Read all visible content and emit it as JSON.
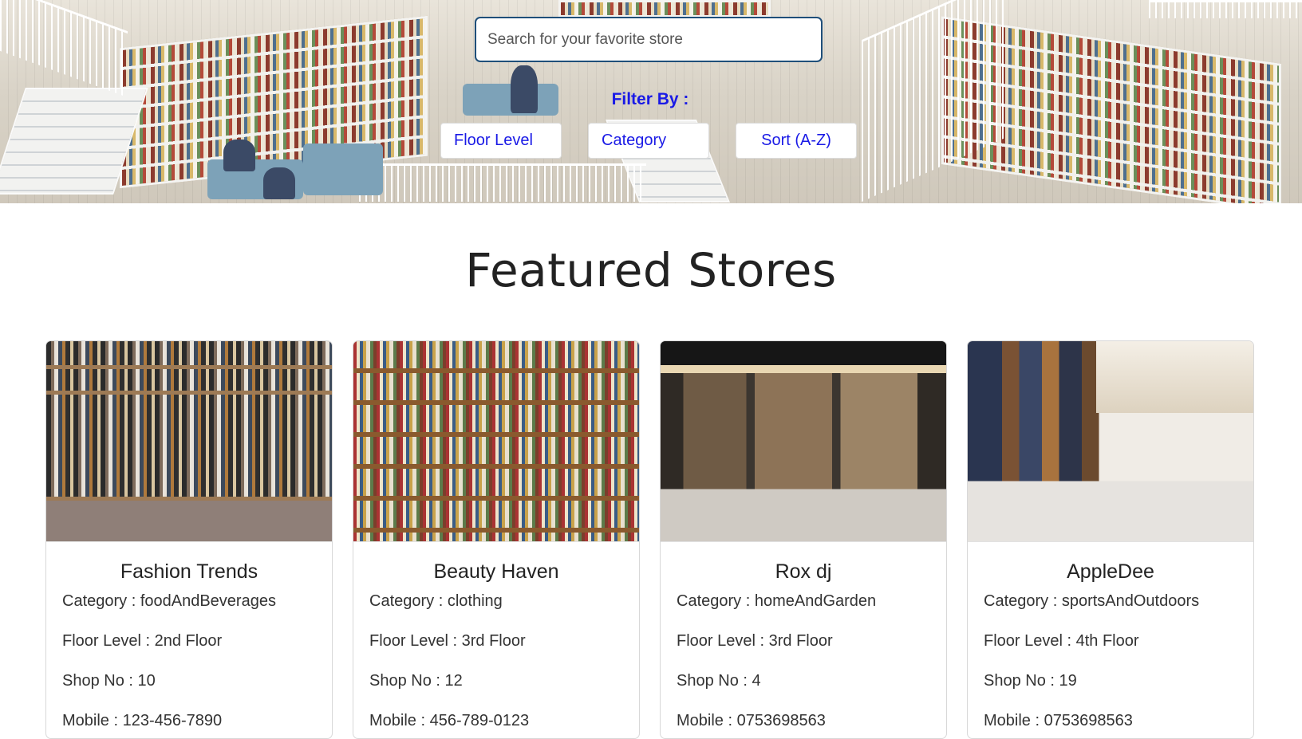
{
  "search": {
    "placeholder": "Search for your favorite store"
  },
  "filters": {
    "label": "Filter By :",
    "floor_level": "Floor Level",
    "category": "Category",
    "sort": "Sort (A-Z)"
  },
  "section": {
    "title": "Featured Stores"
  },
  "stores": [
    {
      "name": "Fashion Trends",
      "category": "Category : foodAndBeverages",
      "floor": "Floor Level : 2nd Floor",
      "shop": "Shop No : 10",
      "mobile": "Mobile : 123-456-7890"
    },
    {
      "name": "Beauty Haven",
      "category": "Category : clothing",
      "floor": "Floor Level : 3rd Floor",
      "shop": "Shop No : 12",
      "mobile": "Mobile : 456-789-0123"
    },
    {
      "name": "Rox dj",
      "category": "Category : homeAndGarden",
      "floor": "Floor Level : 3rd Floor",
      "shop": "Shop No : 4",
      "mobile": "Mobile : 0753698563"
    },
    {
      "name": "AppleDee",
      "category": "Category : sportsAndOutdoors",
      "floor": "Floor Level : 4th Floor",
      "shop": "Shop No : 19",
      "mobile": "Mobile : 0753698563"
    }
  ],
  "colors": {
    "accent": "#1a1ae6",
    "search_border": "#1f4f7a",
    "title": "#222222"
  },
  "icons": {}
}
